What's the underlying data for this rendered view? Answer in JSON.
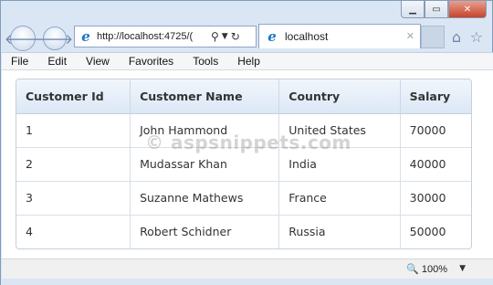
{
  "browser": {
    "address": "http://localhost:4725/(",
    "tab_title": "localhost",
    "tab_close": "✕",
    "caption": {
      "minimize": "▁",
      "maximize": "▭",
      "close": "✕"
    }
  },
  "menu": [
    "File",
    "Edit",
    "View",
    "Favorites",
    "Tools",
    "Help"
  ],
  "grid": {
    "columns": [
      "Customer Id",
      "Customer Name",
      "Country",
      "Salary"
    ],
    "rows": [
      [
        "1",
        "John Hammond",
        "United States",
        "70000"
      ],
      [
        "2",
        "Mudassar Khan",
        "India",
        "40000"
      ],
      [
        "3",
        "Suzanne Mathews",
        "France",
        "30000"
      ],
      [
        "4",
        "Robert Schidner",
        "Russia",
        "50000"
      ]
    ]
  },
  "watermark": "© aspsnippets.com",
  "status": {
    "zoom": "100%"
  },
  "colors": {
    "header_bg": "#dce8f6",
    "frame": "#dbe6f4",
    "close_button": "#c7432b",
    "ie_blue": "#1e73c8"
  },
  "icons": [
    "back-arrow-icon",
    "forward-arrow-icon",
    "ie-logo-icon",
    "search-icon",
    "dropdown-icon",
    "refresh-icon",
    "home-icon",
    "favorites-star-icon",
    "zoom-icon"
  ]
}
